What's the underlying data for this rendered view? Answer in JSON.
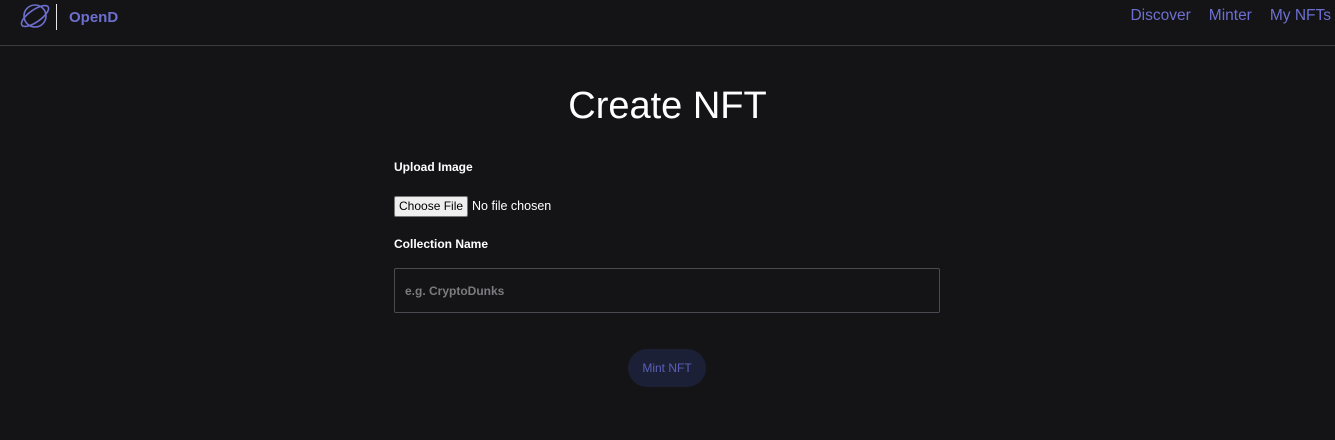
{
  "header": {
    "brand": "OpenD",
    "logo_icon": "planet-ring-icon",
    "nav": {
      "discover": "Discover",
      "minter": "Minter",
      "my_nfts": "My NFTs"
    }
  },
  "main": {
    "title": "Create NFT",
    "upload_label": "Upload Image",
    "file_button": "Choose File",
    "file_status": "No file chosen",
    "collection_label": "Collection Name",
    "collection_placeholder": "e.g. CryptoDunks",
    "mint_button": "Mint NFT"
  },
  "colors": {
    "background": "#141416",
    "accent": "#6d6fd0",
    "button_bg": "#1c2036"
  }
}
